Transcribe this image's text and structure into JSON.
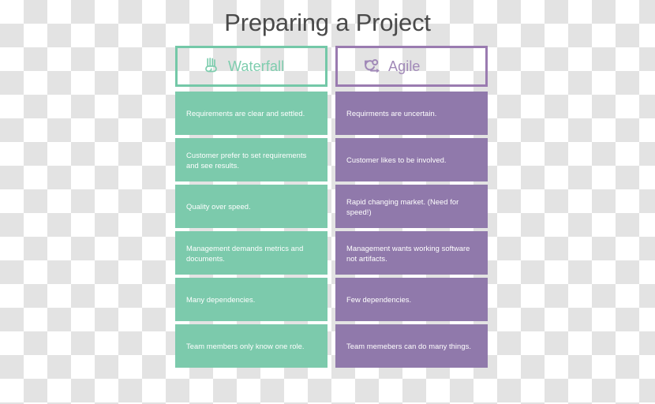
{
  "page": {
    "title": "Preparing a Project",
    "title_color": "#4a4a4a",
    "background": "transparent-checkerboard"
  },
  "comparison_table": {
    "columns": [
      {
        "key": "waterfall",
        "label": "Waterfall",
        "icon": "waterfall-icon",
        "accent_color": "#74c8a8",
        "label_color": "#7ecdae",
        "cell_color": "#7ccaac",
        "cells": [
          "Requirements are clear and settled.",
          "Customer prefer to set requirements and see results.",
          "Quality over speed.",
          "Management demands metrics and documents.",
          "Many dependencies.",
          "Team members only know one role."
        ]
      },
      {
        "key": "agile",
        "label": "Agile",
        "icon": "agile-loop-icon",
        "accent_color": "#9a7bb0",
        "label_color": "#a189b8",
        "cell_color": "#9079ab",
        "cells": [
          "Requirments are uncertain.",
          "Customer likes to be involved.",
          "Rapid changing market. (Need for speed!)",
          "Management wants working software not artifacts.",
          "Few dependencies.",
          "Team memebers can do many things."
        ]
      }
    ],
    "row_count": 6
  }
}
